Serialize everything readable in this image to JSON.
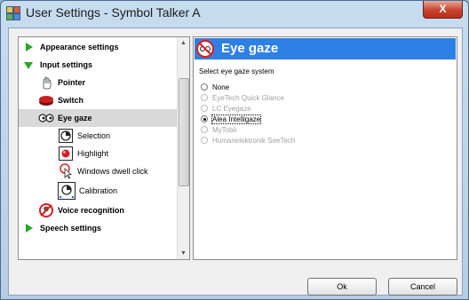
{
  "window": {
    "title": "User Settings - Symbol Talker A",
    "close_glyph": "X"
  },
  "tree": {
    "items": [
      {
        "label": "Appearance settings",
        "icon": "expand-arrow-icon"
      },
      {
        "label": "Input settings",
        "icon": "collapse-arrow-icon"
      },
      {
        "label": "Pointer",
        "icon": "pointer-icon"
      },
      {
        "label": "Switch",
        "icon": "switch-icon"
      },
      {
        "label": "Eye gaze",
        "icon": "eye-gaze-icon"
      },
      {
        "label": "Selection",
        "icon": "selection-icon"
      },
      {
        "label": "Highlight",
        "icon": "highlight-icon"
      },
      {
        "label": "Windows dwell click",
        "icon": "dwell-click-icon"
      },
      {
        "label": "Calibration",
        "icon": "calibration-icon"
      },
      {
        "label": "Voice recognition",
        "icon": "voice-recognition-icon"
      },
      {
        "label": "Speech settings",
        "icon": "expand-arrow-icon"
      }
    ]
  },
  "panel": {
    "title": "Eye gaze",
    "select_label": "Select eye gaze system",
    "options": [
      {
        "label": "None",
        "checked": false,
        "disabled": false
      },
      {
        "label": "EyeTech Quick Glance",
        "checked": false,
        "disabled": true
      },
      {
        "label": "LC Eyegaze",
        "checked": false,
        "disabled": true
      },
      {
        "label": "Alea Intelligaze",
        "checked": true,
        "disabled": false
      },
      {
        "label": "MyTobii",
        "checked": false,
        "disabled": true
      },
      {
        "label": "Humanelektronik SeeTech",
        "checked": false,
        "disabled": true
      }
    ]
  },
  "buttons": {
    "ok": "Ok",
    "cancel": "Cancel"
  },
  "colors": {
    "header_blue": "#2f80e6",
    "close_red": "#c7432d",
    "tree_arrow_green": "#2aa52a"
  }
}
